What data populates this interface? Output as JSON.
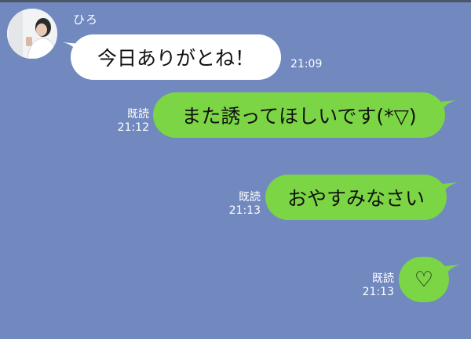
{
  "chat": {
    "sender_name": "ひろ",
    "messages": [
      {
        "direction": "incoming",
        "text": "今日ありがとね！",
        "time": "21:09"
      },
      {
        "direction": "outgoing",
        "text": "また誘ってほしいです(*▽)",
        "read": "既読",
        "time": "21:12"
      },
      {
        "direction": "outgoing",
        "text": "おやすみなさい",
        "read": "既読",
        "time": "21:13"
      },
      {
        "direction": "outgoing",
        "text": "♡",
        "read": "既読",
        "time": "21:13"
      }
    ]
  },
  "colors": {
    "background": "#7189bf",
    "incoming_bubble": "#ffffff",
    "outgoing_bubble": "#7cd545"
  },
  "icons": {
    "avatar": "user-photo-avatar"
  }
}
